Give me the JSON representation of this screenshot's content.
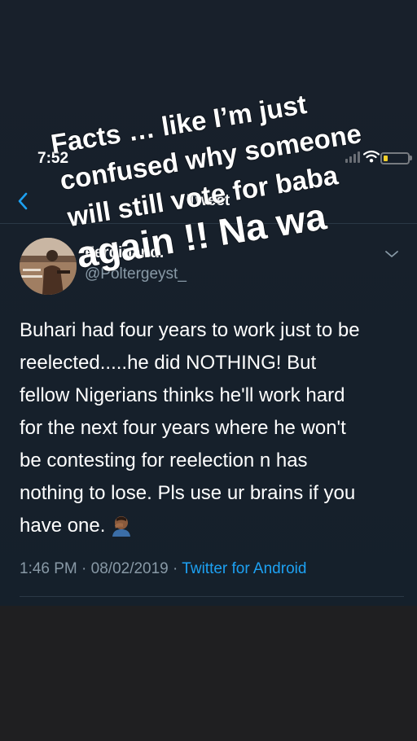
{
  "status_bar": {
    "time": "7:52"
  },
  "nav": {
    "title": "Tweet"
  },
  "tweet": {
    "author_name": "Ferdinand.",
    "author_handle": "@Poltergeyst_",
    "text_lines": [
      "Buhari had four years to work just to be",
      "reelected.....he did NOTHING! But",
      "fellow Nigerians thinks he'll work hard",
      "for the next four years where he won't",
      "be contesting for reelection n has",
      "nothing to lose. Pls use ur brains if you",
      "have one."
    ],
    "time": "1:46 PM",
    "date": "08/02/2019",
    "separator": "·",
    "source": "Twitter for Android"
  },
  "caption": {
    "lines": [
      "Facts … like I’m just",
      "confused why someone",
      "will still vote for baba",
      "again !! Na wa"
    ]
  },
  "colors": {
    "background": "#15202b",
    "text": "#ffffff",
    "secondary": "#8899a6",
    "link": "#1da1f2",
    "battery": "#f3d02a",
    "below_area": "#1f1f21"
  },
  "icons": {
    "back": "chevron-left-icon",
    "caret": "chevron-down-icon",
    "signal": "signal-icon",
    "wifi": "wifi-icon",
    "battery": "battery-icon",
    "emoji": "man-facepalming-emoji"
  }
}
